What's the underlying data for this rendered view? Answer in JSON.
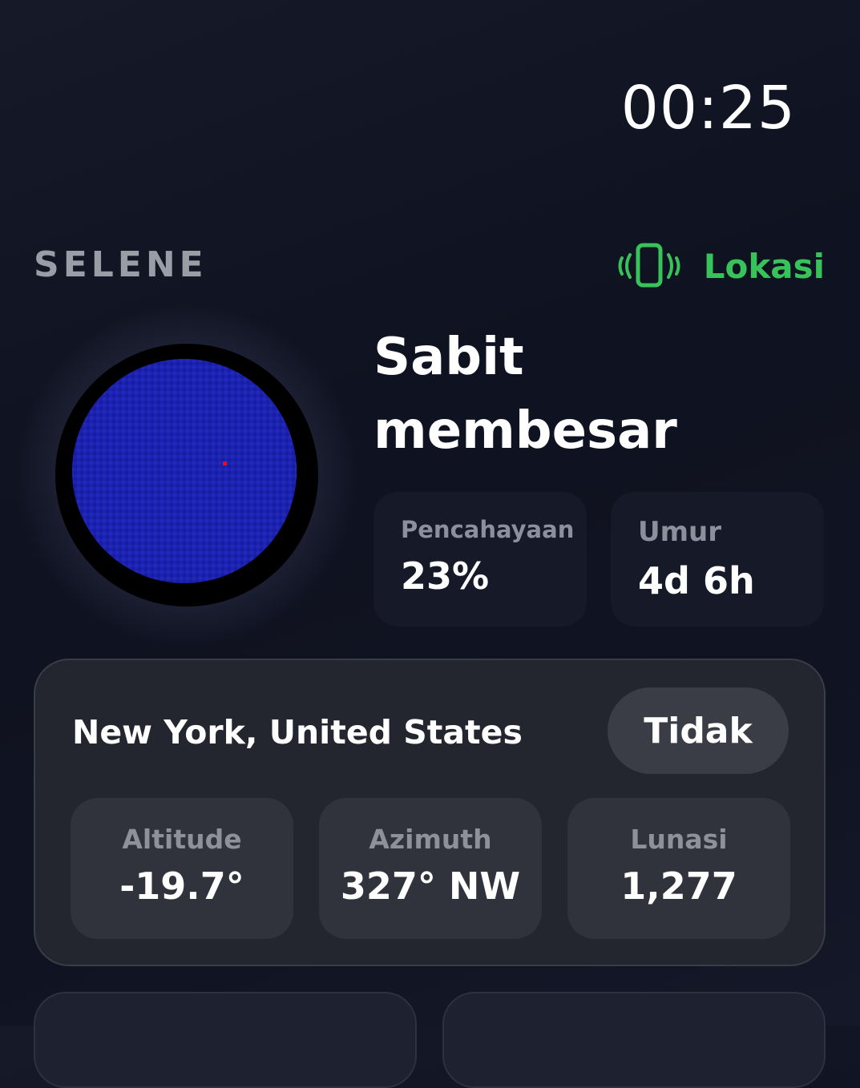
{
  "status": {
    "clock": "00:25"
  },
  "header": {
    "app_name": "SELENE",
    "location_button_label": "Lokasi"
  },
  "moon": {
    "phase_name": "Sabit membesar",
    "illumination_label": "Pencahayaan",
    "illumination_value": "23%",
    "age_label": "Umur",
    "age_value": "4d 6h"
  },
  "location": {
    "title": "New York, United States",
    "toggle_label": "Tidak",
    "metrics": [
      {
        "label": "Altitude",
        "value": "-19.7°"
      },
      {
        "label": "Azimuth",
        "value": "327° NW"
      },
      {
        "label": "Lunasi",
        "value": "1,277"
      }
    ]
  },
  "colors": {
    "accent_green": "#37c25a",
    "moon_dark": "#1a1fa8",
    "moon_lit": "#c9ccd4"
  }
}
